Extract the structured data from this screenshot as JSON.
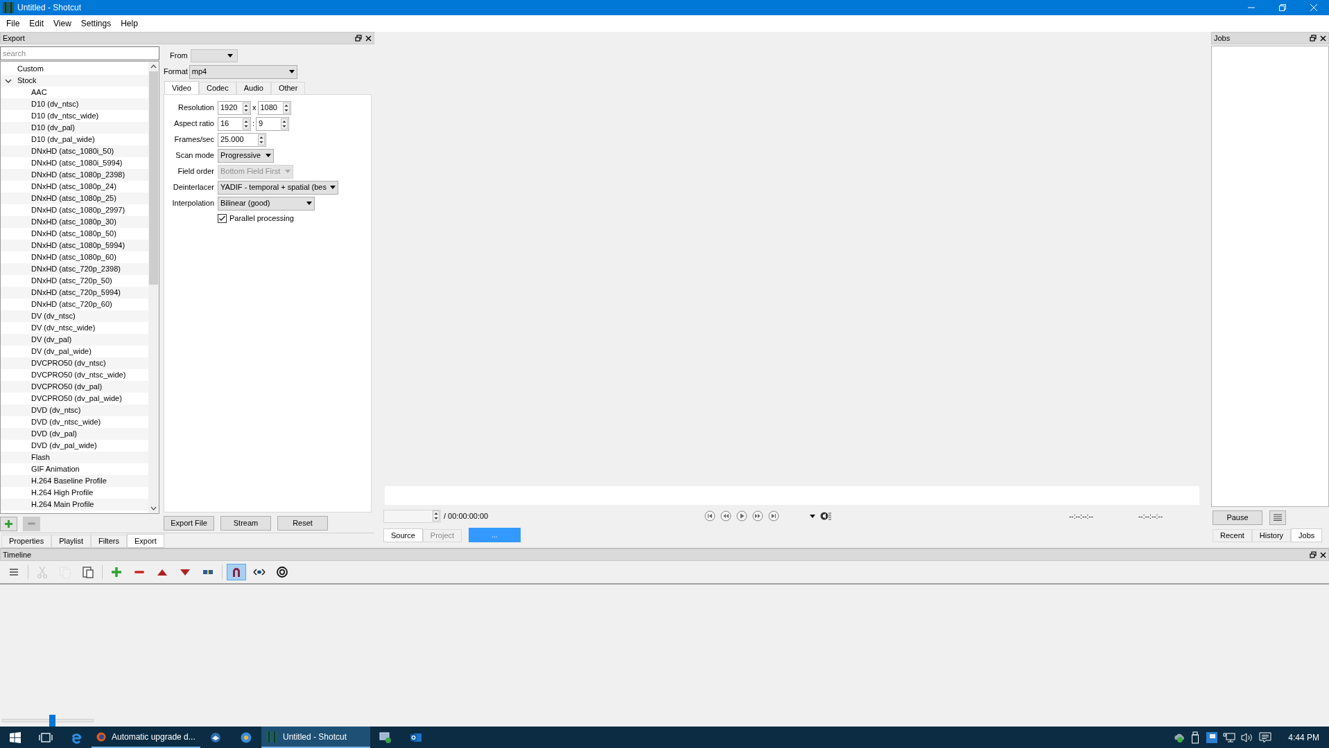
{
  "window": {
    "title": "Untitled - Shotcut"
  },
  "menu": [
    "File",
    "Edit",
    "View",
    "Settings",
    "Help"
  ],
  "export": {
    "title": "Export",
    "search": {
      "placeholder": "search"
    },
    "presets": [
      {
        "label": "Custom"
      },
      {
        "label": "Stock",
        "expanded": true,
        "children": [
          {
            "label": "AAC"
          },
          {
            "label": "D10 (dv_ntsc)"
          },
          {
            "label": "D10 (dv_ntsc_wide)"
          },
          {
            "label": "D10 (dv_pal)"
          },
          {
            "label": "D10 (dv_pal_wide)"
          },
          {
            "label": "DNxHD (atsc_1080i_50)"
          },
          {
            "label": "DNxHD (atsc_1080i_5994)"
          },
          {
            "label": "DNxHD (atsc_1080p_2398)"
          },
          {
            "label": "DNxHD (atsc_1080p_24)"
          },
          {
            "label": "DNxHD (atsc_1080p_25)"
          },
          {
            "label": "DNxHD (atsc_1080p_2997)"
          },
          {
            "label": "DNxHD (atsc_1080p_30)"
          },
          {
            "label": "DNxHD (atsc_1080p_50)"
          },
          {
            "label": "DNxHD (atsc_1080p_5994)"
          },
          {
            "label": "DNxHD (atsc_1080p_60)"
          },
          {
            "label": "DNxHD (atsc_720p_2398)"
          },
          {
            "label": "DNxHD (atsc_720p_50)"
          },
          {
            "label": "DNxHD (atsc_720p_5994)"
          },
          {
            "label": "DNxHD (atsc_720p_60)"
          },
          {
            "label": "DV (dv_ntsc)"
          },
          {
            "label": "DV (dv_ntsc_wide)"
          },
          {
            "label": "DV (dv_pal)"
          },
          {
            "label": "DV (dv_pal_wide)"
          },
          {
            "label": "DVCPRO50 (dv_ntsc)"
          },
          {
            "label": "DVCPRO50 (dv_ntsc_wide)"
          },
          {
            "label": "DVCPRO50 (dv_pal)"
          },
          {
            "label": "DVCPRO50 (dv_pal_wide)"
          },
          {
            "label": "DVD (dv_ntsc)"
          },
          {
            "label": "DVD (dv_ntsc_wide)"
          },
          {
            "label": "DVD (dv_pal)"
          },
          {
            "label": "DVD (dv_pal_wide)"
          },
          {
            "label": "Flash"
          },
          {
            "label": "GIF Animation"
          },
          {
            "label": "H.264 Baseline Profile"
          },
          {
            "label": "H.264 High Profile"
          },
          {
            "label": "H.264 Main Profile"
          }
        ]
      }
    ],
    "from": {
      "label": "From"
    },
    "format": {
      "label": "Format",
      "value": "mp4"
    },
    "tabs": [
      {
        "label": "Video",
        "selected": true
      },
      {
        "label": "Codec",
        "selected": false
      },
      {
        "label": "Audio",
        "selected": false
      },
      {
        "label": "Other",
        "selected": false
      }
    ],
    "fields": [
      {
        "kind": "pair",
        "label": "Resolution",
        "values": [
          "1920",
          "1080"
        ],
        "separator": "x"
      },
      {
        "kind": "pair",
        "label": "Aspect ratio",
        "values": [
          "16",
          "9"
        ],
        "separator": ":"
      },
      {
        "kind": "spin",
        "label": "Frames/sec",
        "value": "25.000"
      },
      {
        "kind": "combo",
        "label": "Scan mode",
        "value": "Progressive",
        "disabled": false
      },
      {
        "kind": "combo",
        "label": "Field order",
        "value": "Bottom Field First",
        "disabled": true
      },
      {
        "kind": "combo",
        "label": "Deinterlacer",
        "value": "YADIF - temporal + spatial (bes",
        "disabled": false
      },
      {
        "kind": "combo",
        "label": "Interpolation",
        "value": "Bilinear (good)",
        "disabled": false
      },
      {
        "kind": "checkbox",
        "label": "Parallel processing",
        "checked": true
      }
    ],
    "buttons": [
      "Export File",
      "Stream",
      "Reset"
    ]
  },
  "dock_tabs": [
    {
      "label": "Properties",
      "selected": false
    },
    {
      "label": "Playlist",
      "selected": false
    },
    {
      "label": "Filters",
      "selected": false
    },
    {
      "label": "Export",
      "selected": true
    }
  ],
  "player": {
    "duration": "/ 00:00:00:00",
    "in_point": "--:--:--:--",
    "out_point": "--:--:--:--",
    "tabs": [
      {
        "label": "Source",
        "selected": true,
        "disabled": false
      },
      {
        "label": "Project",
        "selected": false,
        "disabled": true
      }
    ],
    "progress_button": "..."
  },
  "jobs": {
    "title": "Jobs",
    "pause": "Pause",
    "tabs": [
      {
        "label": "Recent",
        "selected": false
      },
      {
        "label": "History",
        "selected": false
      },
      {
        "label": "Jobs",
        "selected": true
      }
    ]
  },
  "timeline": {
    "title": "Timeline",
    "toolbar": [
      {
        "kind": "menu",
        "disabled": false,
        "selected": false
      },
      {
        "kind": "sep"
      },
      {
        "kind": "cut",
        "disabled": true,
        "selected": false
      },
      {
        "kind": "copy",
        "disabled": true,
        "selected": false
      },
      {
        "kind": "paste",
        "disabled": false,
        "selected": false
      },
      {
        "kind": "sep"
      },
      {
        "kind": "append",
        "disabled": false,
        "selected": false
      },
      {
        "kind": "remove",
        "disabled": false,
        "selected": false
      },
      {
        "kind": "lift",
        "disabled": false,
        "selected": false
      },
      {
        "kind": "overwrite",
        "disabled": false,
        "selected": false
      },
      {
        "kind": "split",
        "disabled": false,
        "selected": false
      },
      {
        "kind": "sep"
      },
      {
        "kind": "snap",
        "disabled": false,
        "selected": true
      },
      {
        "kind": "scrub",
        "disabled": false,
        "selected": false
      },
      {
        "kind": "ripple",
        "disabled": false,
        "selected": false
      }
    ],
    "zoom": {
      "level": 0.55
    }
  },
  "taskbar": {
    "items": [
      {
        "kind": "start"
      },
      {
        "kind": "task-view"
      },
      {
        "kind": "e-browser"
      },
      {
        "kind": "fox-browser",
        "label": "Automatic upgrade d...",
        "active": false
      },
      {
        "kind": "bird-mail"
      },
      {
        "kind": "compass"
      },
      {
        "kind": "film",
        "label": "Untitled - Shotcut",
        "active": true
      },
      {
        "kind": "remote"
      },
      {
        "kind": "mail"
      }
    ],
    "tray": [
      {
        "kind": "cloud"
      },
      {
        "kind": "usb"
      },
      {
        "kind": "app"
      },
      {
        "kind": "network"
      },
      {
        "kind": "volume"
      },
      {
        "kind": "notifications"
      }
    ],
    "clock": "4:44 PM"
  }
}
